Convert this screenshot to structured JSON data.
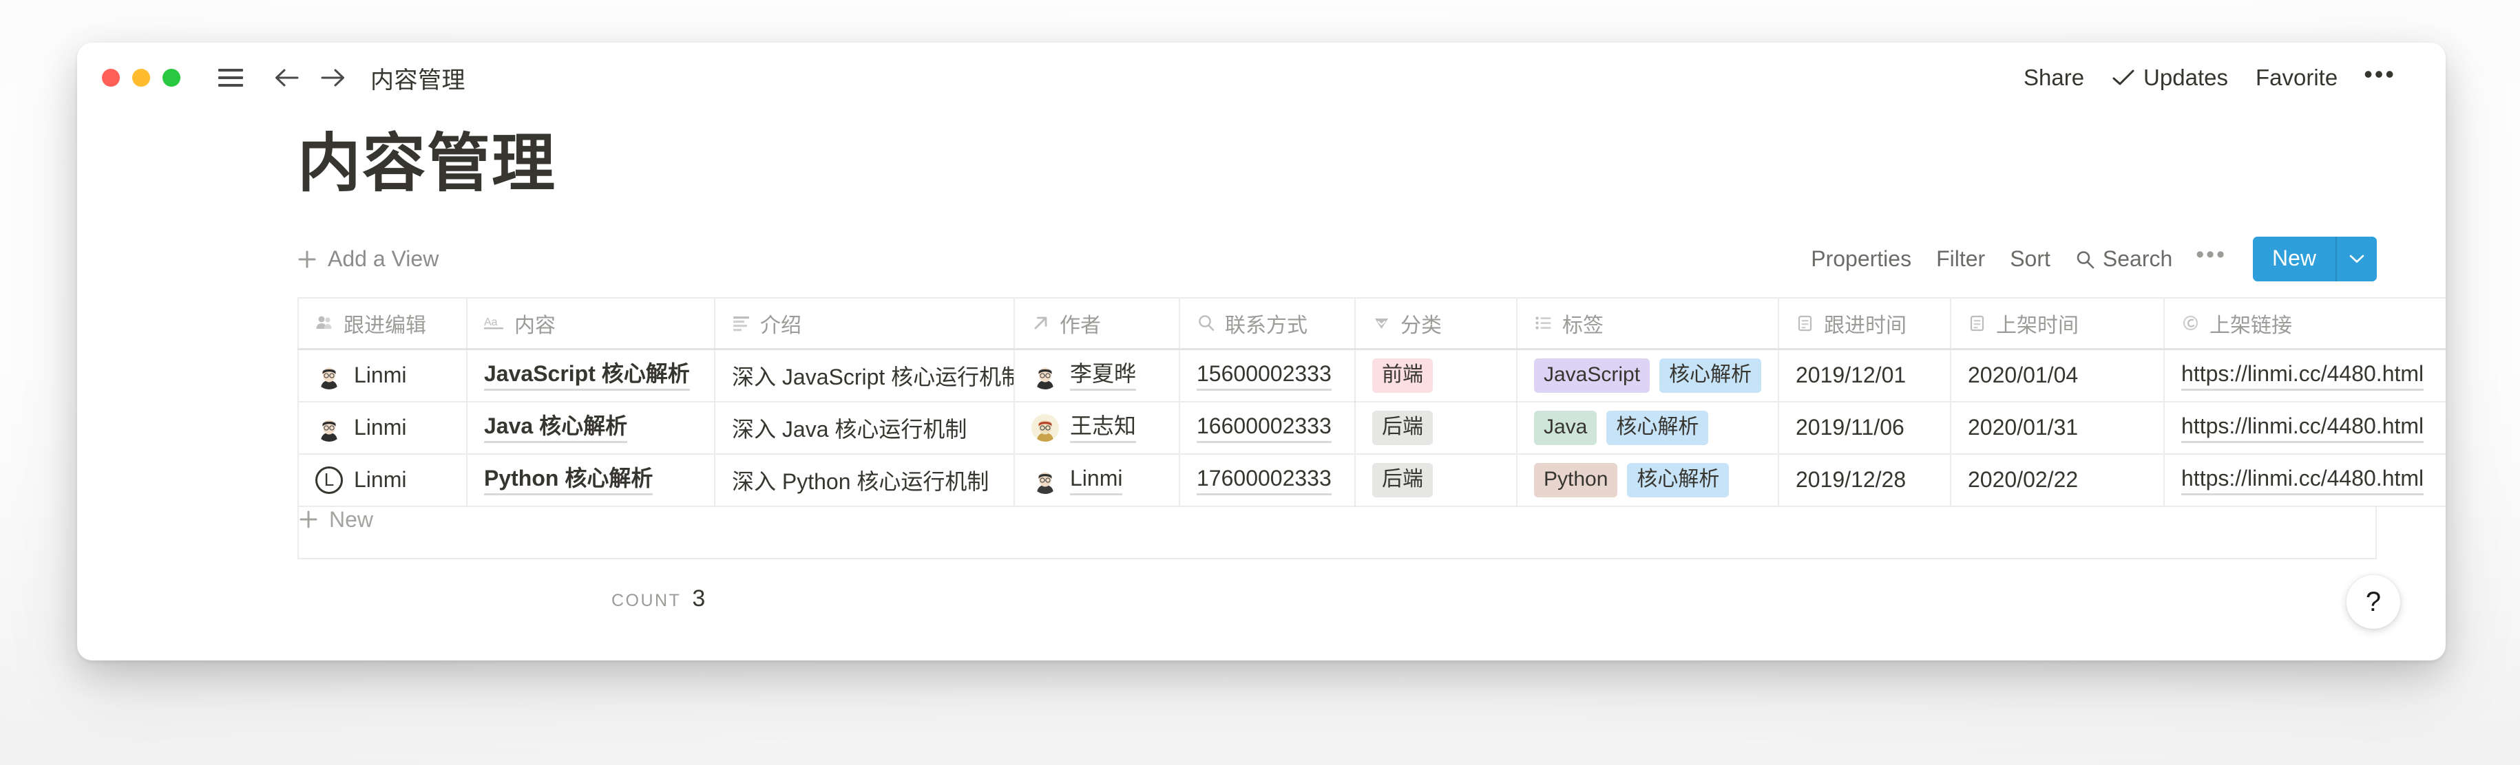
{
  "window": {
    "traffic_lights": [
      "close",
      "minimize",
      "maximize"
    ],
    "breadcrumb": "内容管理",
    "actions": {
      "share": "Share",
      "updates": "Updates",
      "favorite": "Favorite",
      "more": "•••"
    }
  },
  "page": {
    "title": "内容管理"
  },
  "view_toolbar": {
    "add_view": "Add a View",
    "properties": "Properties",
    "filter": "Filter",
    "sort": "Sort",
    "search": "Search",
    "more": "•••",
    "new_button": "New"
  },
  "table": {
    "columns": [
      {
        "label": "跟进编辑",
        "icon": "person-icon"
      },
      {
        "label": "内容",
        "icon": "text-aa-icon"
      },
      {
        "label": "介绍",
        "icon": "paragraph-icon"
      },
      {
        "label": "作者",
        "icon": "arrow-up-right-icon"
      },
      {
        "label": "联系方式",
        "icon": "search-icon"
      },
      {
        "label": "分类",
        "icon": "select-dropdown-icon"
      },
      {
        "label": "标签",
        "icon": "multi-select-icon"
      },
      {
        "label": "跟进时间",
        "icon": "calendar-icon"
      },
      {
        "label": "上架时间",
        "icon": "calendar-icon"
      },
      {
        "label": "上架链接",
        "icon": "link-icon"
      }
    ],
    "rows": [
      {
        "editor": "Linmi",
        "editor_avatar": "photo",
        "content": "JavaScript 核心解析",
        "intro": "深入 JavaScript 核心运行机制",
        "author": "李夏晔",
        "author_avatar": "photo",
        "contact": "15600002333",
        "category": {
          "text": "前端",
          "bg": "#fbdfe2",
          "fg": "#37352f"
        },
        "tags": [
          {
            "text": "JavaScript",
            "bg": "#ddd3f5",
            "fg": "#37352f"
          },
          {
            "text": "核心解析",
            "bg": "#c7e3f7",
            "fg": "#37352f"
          }
        ],
        "follow_date": "2019/12/01",
        "publish_date": "2020/01/04",
        "link": "https://linmi.cc/4480.html"
      },
      {
        "editor": "Linmi",
        "editor_avatar": "photo",
        "content": "Java 核心解析",
        "intro": "深入 Java 核心运行机制",
        "author": "王志知",
        "author_avatar": "photo2",
        "contact": "16600002333",
        "category": {
          "text": "后端",
          "bg": "#e6e6e4",
          "fg": "#37352f"
        },
        "tags": [
          {
            "text": "Java",
            "bg": "#cfe5d9",
            "fg": "#37352f"
          },
          {
            "text": "核心解析",
            "bg": "#c7e3f7",
            "fg": "#37352f"
          }
        ],
        "follow_date": "2019/11/06",
        "publish_date": "2020/01/31",
        "link": "https://linmi.cc/4480.html"
      },
      {
        "editor": "Linmi",
        "editor_avatar": "ring-L",
        "content": "Python 核心解析",
        "intro": "深入 Python 核心运行机制",
        "author": "Linmi",
        "author_avatar": "photo3",
        "contact": "17600002333",
        "category": {
          "text": "后端",
          "bg": "#e6e6e4",
          "fg": "#37352f"
        },
        "tags": [
          {
            "text": "Python",
            "bg": "#e8d5cd",
            "fg": "#37352f"
          },
          {
            "text": "核心解析",
            "bg": "#c7e3f7",
            "fg": "#37352f"
          }
        ],
        "follow_date": "2019/12/28",
        "publish_date": "2020/02/22",
        "link": "https://linmi.cc/4480.html"
      }
    ],
    "new_row_label": "New",
    "count_label": "COUNT",
    "count_value": "3"
  },
  "help": {
    "glyph": "?"
  },
  "colors": {
    "accent": "#2f9fdb",
    "text": "#37352f",
    "muted": "#9b9b98",
    "border": "#ececeb"
  }
}
